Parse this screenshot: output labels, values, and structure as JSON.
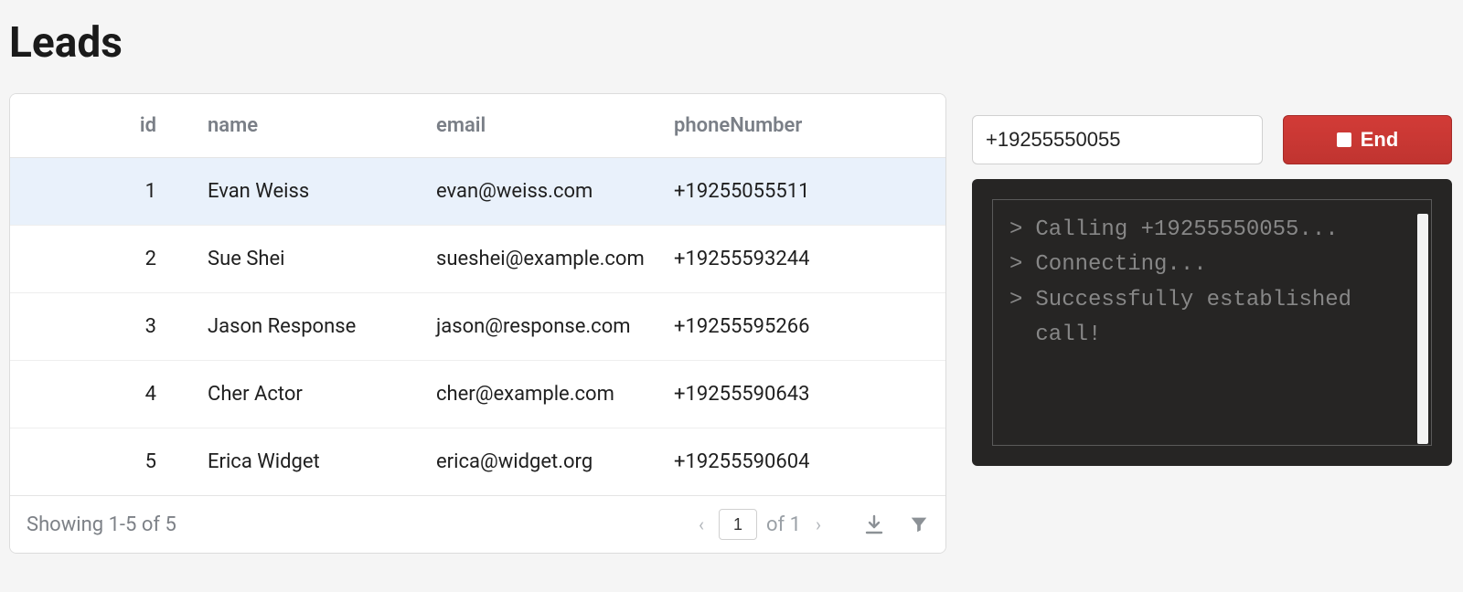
{
  "page": {
    "title": "Leads"
  },
  "table": {
    "columns": {
      "id": "id",
      "name": "name",
      "email": "email",
      "phone": "phoneNumber"
    },
    "rows": [
      {
        "id": "1",
        "name": "Evan Weiss",
        "email": "evan@weiss.com",
        "phone": "+19255055511",
        "selected": true
      },
      {
        "id": "2",
        "name": "Sue Shei",
        "email": "sueshei@example.com",
        "phone": "+19255593244",
        "selected": false
      },
      {
        "id": "3",
        "name": "Jason Response",
        "email": "jason@response.com",
        "phone": "+19255595266",
        "selected": false
      },
      {
        "id": "4",
        "name": "Cher Actor",
        "email": "cher@example.com",
        "phone": "+19255590643",
        "selected": false
      },
      {
        "id": "5",
        "name": "Erica Widget",
        "email": "erica@widget.org",
        "phone": "+19255590604",
        "selected": false
      }
    ],
    "footer": {
      "showing": "Showing 1-5 of 5",
      "page": "1",
      "of": "of 1"
    }
  },
  "dialer": {
    "phone_value": "+19255550055",
    "end_label": "End"
  },
  "terminal": {
    "lines": [
      "Calling +19255550055...",
      "Connecting...",
      "Successfully established call!"
    ]
  }
}
